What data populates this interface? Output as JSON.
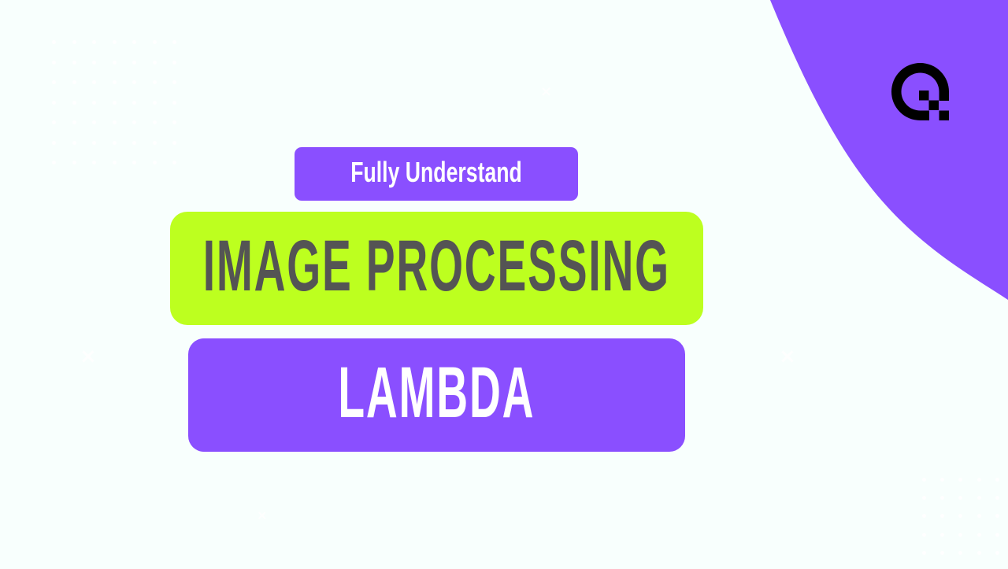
{
  "colors": {
    "background": "#f8fffd",
    "accent_purple": "#8a4fff",
    "accent_lime": "#bdff1f",
    "headline_text": "#545454",
    "light_text": "#ffffff",
    "logo": "#000000"
  },
  "banner": {
    "kicker": "Fully Understand",
    "title": "IMAGE PROCESSING",
    "subtitle": "LAMBDA"
  },
  "decorations": {
    "cross_glyph": "×",
    "logo_icon": "brand-logo-icon"
  }
}
